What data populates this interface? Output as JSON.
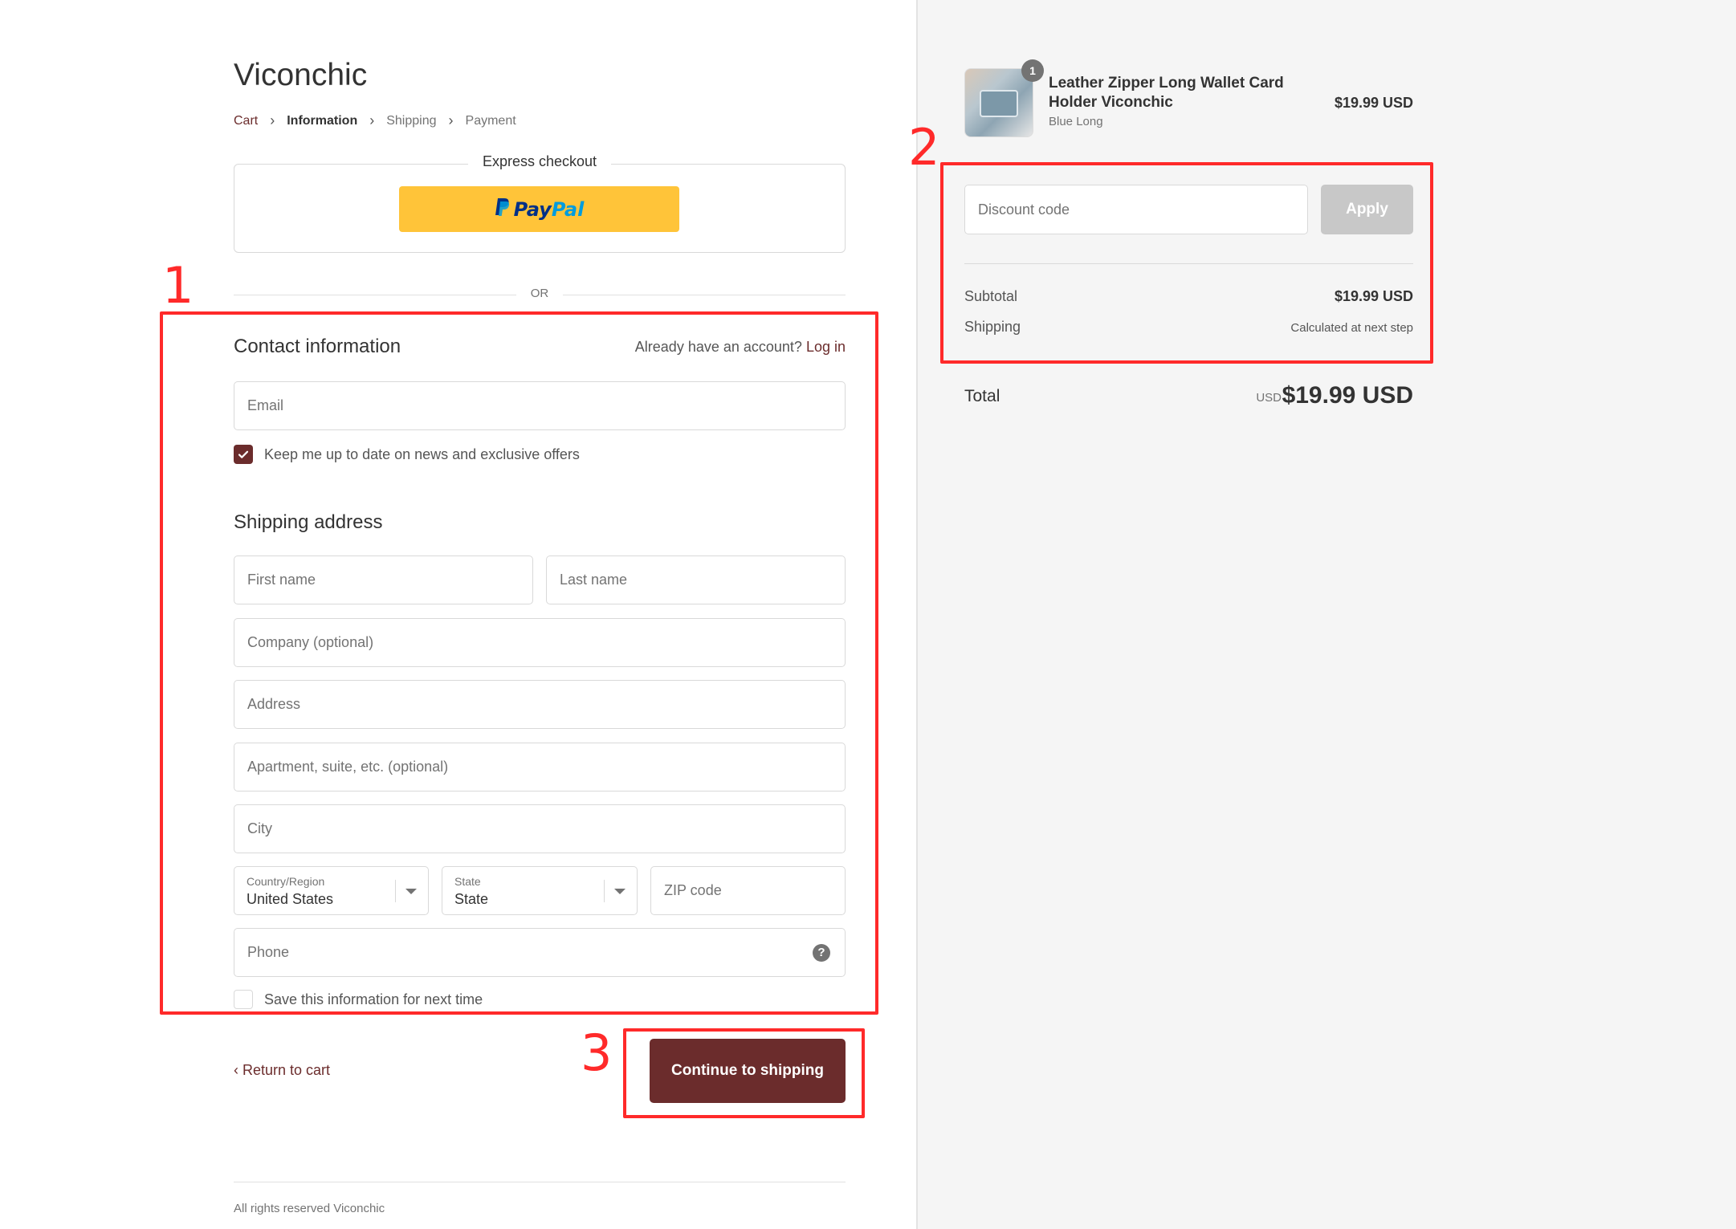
{
  "shop": {
    "name": "Viconchic"
  },
  "breadcrumb": [
    "Cart",
    "Information",
    "Shipping",
    "Payment"
  ],
  "express": {
    "title": "Express checkout",
    "paypal_pay": "Pay",
    "paypal_pal": "Pal"
  },
  "divider": {
    "or": "OR"
  },
  "contact": {
    "title": "Contact information",
    "account_prompt": "Already have an account?",
    "login_link": "Log in",
    "email_placeholder": "Email",
    "newsletter_label": "Keep me up to date on news and exclusive offers",
    "newsletter_checked": true
  },
  "shipping": {
    "title": "Shipping address",
    "first_name": "First name",
    "last_name": "Last name",
    "company": "Company (optional)",
    "address": "Address",
    "apartment": "Apartment, suite, etc. (optional)",
    "city": "City",
    "country_label": "Country/Region",
    "country_value": "United States",
    "state_label": "State",
    "state_value": "State",
    "zip": "ZIP code",
    "phone": "Phone",
    "save_label": "Save this information for next time",
    "save_checked": false
  },
  "actions": {
    "return": "Return to cart",
    "continue": "Continue to shipping"
  },
  "footer": {
    "text": "All rights reserved Viconchic"
  },
  "summary": {
    "product": {
      "name": "Leather Zipper Long Wallet Card Holder Viconchic",
      "variant": "Blue Long",
      "price": "$19.99 USD",
      "quantity": "1"
    },
    "discount_placeholder": "Discount code",
    "apply_label": "Apply",
    "subtotal_label": "Subtotal",
    "subtotal_value": "$19.99 USD",
    "shipping_label": "Shipping",
    "shipping_value": "Calculated at next step",
    "total_label": "Total",
    "total_currency": "USD",
    "total_value": "$19.99 USD"
  },
  "annotations": [
    "1",
    "2",
    "3"
  ],
  "colors": {
    "accent": "#6b2c2c",
    "annotation": "#ff2a2a",
    "paypal": "#ffc439",
    "sidebar_bg": "#f5f5f5"
  }
}
